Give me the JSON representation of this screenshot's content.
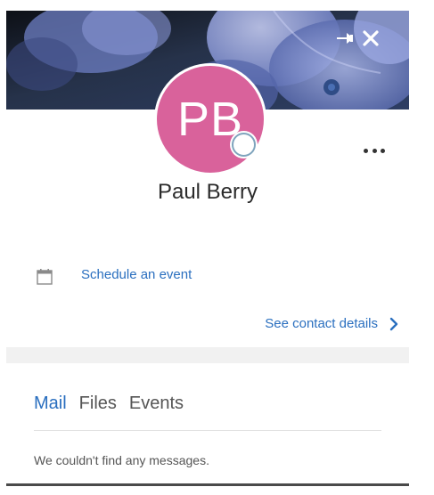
{
  "contact": {
    "initials": "PB",
    "name": "Paul Berry",
    "avatar_color": "#d9629b",
    "presence": "offline"
  },
  "actions": {
    "schedule_event": "Schedule an event",
    "see_contact_details": "See contact details"
  },
  "header": {
    "pin_icon": "pin-icon",
    "close_icon": "close-icon",
    "more_icon": "more-options-icon"
  },
  "tabs": [
    {
      "label": "Mail",
      "active": true
    },
    {
      "label": "Files",
      "active": false
    },
    {
      "label": "Events",
      "active": false
    }
  ],
  "mail": {
    "empty_message": "We couldn't find any messages."
  },
  "colors": {
    "accent": "#2a6fbf",
    "header_bg": "#1b2230"
  }
}
